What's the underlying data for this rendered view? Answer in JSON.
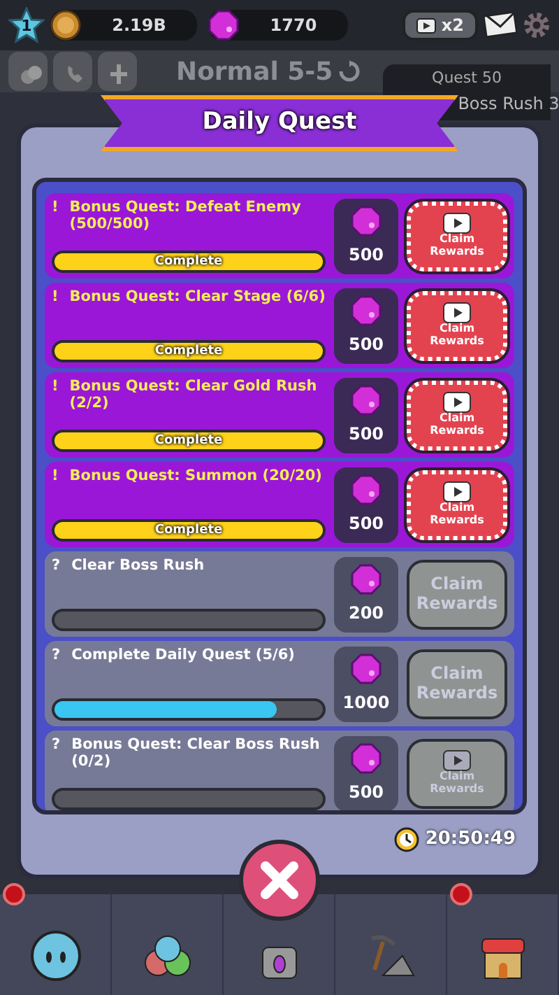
{
  "top_bar": {
    "level": "1",
    "coins": "2.19B",
    "gems": "1770",
    "ad_boost": "x2"
  },
  "sub_bar": {
    "stage": "Normal 5-5",
    "quest_panel": {
      "quest": "Quest 50",
      "task": "Boss Rush 3"
    }
  },
  "dialog": {
    "title": "Daily Quest",
    "timer": "20:50:49",
    "quests": [
      {
        "marker": "!",
        "title": "Bonus Quest: Defeat Enemy (500/500)",
        "kind": "complete",
        "level": 1,
        "bar_text": "Complete",
        "reward": "500",
        "button": {
          "label": "Claim Rewards",
          "video": true,
          "enabled": true
        }
      },
      {
        "marker": "!",
        "title": "Bonus Quest: Clear Stage (6/6)",
        "kind": "complete",
        "level": 1,
        "bar_text": "Complete",
        "reward": "500",
        "button": {
          "label": "Claim Rewards",
          "video": true,
          "enabled": true
        }
      },
      {
        "marker": "!",
        "title": "Bonus Quest: Clear Gold Rush (2/2)",
        "kind": "complete",
        "level": 1,
        "bar_text": "Complete",
        "reward": "500",
        "button": {
          "label": "Claim Rewards",
          "video": true,
          "enabled": true
        }
      },
      {
        "marker": "!",
        "title": "Bonus Quest: Summon (20/20)",
        "kind": "complete",
        "level": 1,
        "bar_text": "Complete",
        "reward": "500",
        "button": {
          "label": "Claim Rewards",
          "video": true,
          "enabled": true
        }
      },
      {
        "marker": "?",
        "title": "Clear Boss Rush",
        "kind": "pending",
        "level": 0,
        "reward": "200",
        "button": {
          "label": "Claim Rewards",
          "video": false,
          "enabled": false
        }
      },
      {
        "marker": "?",
        "title": "Complete Daily Quest (5/6)",
        "kind": "pending",
        "level": 0.83,
        "reward": "1000",
        "button": {
          "label": "Claim Rewards",
          "video": false,
          "enabled": false
        }
      },
      {
        "marker": "?",
        "title": "Bonus Quest: Clear Boss Rush (0/2)",
        "kind": "pending",
        "level": 0,
        "reward": "500",
        "button": {
          "label": "Claim Rewards",
          "video": true,
          "enabled": false
        }
      }
    ]
  },
  "nav": [
    {
      "notification": true
    },
    {
      "notification": false
    },
    {
      "notification": false
    },
    {
      "notification": false
    },
    {
      "notification": true
    }
  ]
}
